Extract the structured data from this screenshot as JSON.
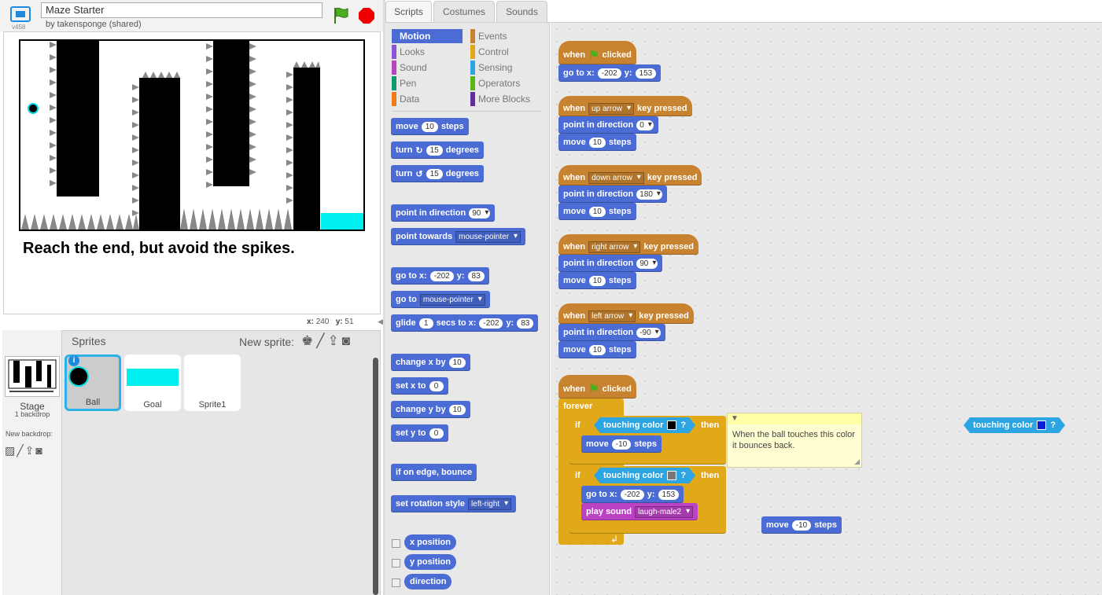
{
  "project": {
    "title": "Maze Starter",
    "byline": "by takensponge (shared)",
    "version": "v458"
  },
  "stage": {
    "message": "Reach the end, but avoid the spikes.",
    "coords": {
      "x_label": "x:",
      "x": "240",
      "y_label": "y:",
      "y": "51"
    }
  },
  "sprites_panel": {
    "header": "Sprites",
    "new_sprite_label": "New sprite:",
    "stage_label": "Stage",
    "stage_backdrops": "1 backdrop",
    "new_backdrop_label": "New backdrop:",
    "sprites": [
      {
        "name": "Ball"
      },
      {
        "name": "Goal"
      },
      {
        "name": "Sprite1"
      }
    ]
  },
  "tabs": [
    "Scripts",
    "Costumes",
    "Sounds"
  ],
  "categories": [
    {
      "label": "Motion",
      "color": "#4a6cd4"
    },
    {
      "label": "Looks",
      "color": "#8a55d7"
    },
    {
      "label": "Sound",
      "color": "#bb42c3"
    },
    {
      "label": "Pen",
      "color": "#0e9a6c"
    },
    {
      "label": "Data",
      "color": "#ee7d16"
    },
    {
      "label": "Events",
      "color": "#c88330"
    },
    {
      "label": "Control",
      "color": "#e1a91a"
    },
    {
      "label": "Sensing",
      "color": "#2ca5e2"
    },
    {
      "label": "Operators",
      "color": "#5cb712"
    },
    {
      "label": "More Blocks",
      "color": "#632d99"
    }
  ],
  "palette": {
    "move": [
      "move",
      "10",
      "steps"
    ],
    "turn_right": [
      "turn",
      "15",
      "degrees"
    ],
    "turn_left": [
      "turn",
      "15",
      "degrees"
    ],
    "point_dir": [
      "point in direction",
      "90"
    ],
    "point_towards": [
      "point towards",
      "mouse-pointer"
    ],
    "goto_xy": [
      "go to x:",
      "-202",
      "y:",
      "83"
    ],
    "goto": [
      "go to",
      "mouse-pointer"
    ],
    "glide": [
      "glide",
      "1",
      "secs to x:",
      "-202",
      "y:",
      "83"
    ],
    "change_x": [
      "change x by",
      "10"
    ],
    "set_x": [
      "set x to",
      "0"
    ],
    "change_y": [
      "change y by",
      "10"
    ],
    "set_y": [
      "set y to",
      "0"
    ],
    "bounce": "if on edge, bounce",
    "rotation": [
      "set rotation style",
      "left-right"
    ],
    "reporters": [
      "x position",
      "y position",
      "direction"
    ]
  },
  "scripts": {
    "s1": {
      "hat": [
        "when",
        "clicked"
      ],
      "goto": [
        "go to x:",
        "-202",
        "y:",
        "153"
      ]
    },
    "s2": {
      "hat": [
        "when",
        "up arrow",
        "key pressed"
      ],
      "point": [
        "point in direction",
        "0"
      ],
      "move": [
        "move",
        "10",
        "steps"
      ]
    },
    "s3": {
      "hat": [
        "when",
        "down arrow",
        "key pressed"
      ],
      "point": [
        "point in direction",
        "180"
      ],
      "move": [
        "move",
        "10",
        "steps"
      ]
    },
    "s4": {
      "hat": [
        "when",
        "right arrow",
        "key pressed"
      ],
      "point": [
        "point in direction",
        "90"
      ],
      "move": [
        "move",
        "10",
        "steps"
      ]
    },
    "s5": {
      "hat": [
        "when",
        "left arrow",
        "key pressed"
      ],
      "point": [
        "point in direction",
        "-90"
      ],
      "move": [
        "move",
        "10",
        "steps"
      ]
    },
    "s6": {
      "hat": [
        "when",
        "clicked"
      ],
      "forever": "forever",
      "if1": [
        "if",
        "touching color",
        "?",
        "then"
      ],
      "move": [
        "move",
        "-10",
        "steps"
      ],
      "if2": [
        "if",
        "touching color",
        "?",
        "then"
      ],
      "goto": [
        "go to x:",
        "-202",
        "y:",
        "153"
      ],
      "sound": [
        "play sound",
        "laugh-male2"
      ]
    },
    "loose_touching": [
      "touching color",
      "?"
    ],
    "loose_move": [
      "move",
      "-10",
      "steps"
    ],
    "comment": "When the ball touches this color it bounces back."
  },
  "colors": {
    "touch_black": "#000000",
    "touch_gray": "#777777",
    "touch_blue": "#0a1fd6",
    "goal": "#00f0f0"
  }
}
